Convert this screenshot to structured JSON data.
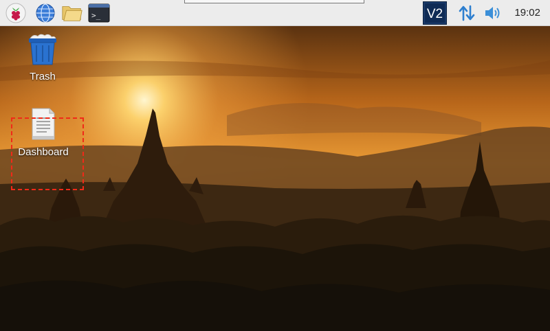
{
  "taskbar": {
    "launchers": [
      {
        "name": "raspberry-menu-icon"
      },
      {
        "name": "web-browser-icon"
      },
      {
        "name": "file-manager-icon"
      },
      {
        "name": "terminal-icon",
        "glyph": ">_"
      }
    ],
    "tray": {
      "vnc_label": "V2",
      "network_icon": "network-updown-icon",
      "volume_icon": "volume-icon"
    },
    "clock": "19:02"
  },
  "desktop": {
    "icons": [
      {
        "name": "trash",
        "label": "Trash"
      },
      {
        "name": "dashboard",
        "label": "Dashboard"
      }
    ]
  },
  "colors": {
    "highlight": "#f02a18",
    "sky_top": "#6a3a10",
    "sky_glow": "#ffd06a",
    "silhouette": "#2a1a0c"
  }
}
